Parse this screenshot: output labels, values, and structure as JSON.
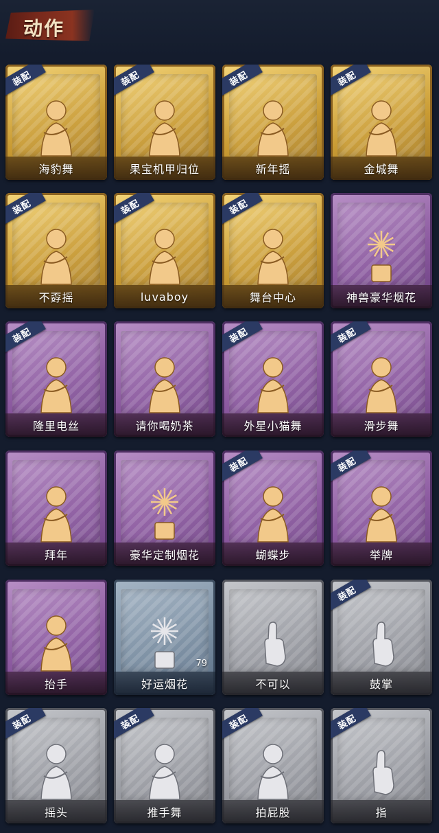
{
  "title": "动作",
  "equip_tag": "装配",
  "colors": {
    "gold": "#c99b33",
    "purple": "#8c5aa0",
    "blue": "#7a8ea2",
    "gray": "#9a9ca3",
    "tag": "#2b3a63"
  },
  "actions": [
    {
      "label": "海豹舞",
      "tier": "gold",
      "equipped": true,
      "icon": "dance-figure-icon"
    },
    {
      "label": "果宝机甲归位",
      "tier": "gold",
      "equipped": true,
      "icon": "dance-figure-icon"
    },
    {
      "label": "新年摇",
      "tier": "gold",
      "equipped": true,
      "icon": "dance-figure-icon"
    },
    {
      "label": "金城舞",
      "tier": "gold",
      "equipped": true,
      "icon": "dance-figure-icon"
    },
    {
      "label": "不孬摇",
      "tier": "gold",
      "equipped": true,
      "icon": "dance-figure-icon"
    },
    {
      "label": "luvaboy",
      "tier": "gold",
      "equipped": true,
      "icon": "dance-figure-icon"
    },
    {
      "label": "舞台中心",
      "tier": "gold",
      "equipped": true,
      "icon": "dance-figure-icon"
    },
    {
      "label": "神兽豪华烟花",
      "tier": "purple",
      "equipped": false,
      "icon": "firework-icon"
    },
    {
      "label": "隆里电丝",
      "tier": "purple",
      "equipped": true,
      "icon": "dance-figure-icon"
    },
    {
      "label": "请你喝奶茶",
      "tier": "purple",
      "equipped": false,
      "icon": "dance-figure-icon"
    },
    {
      "label": "外星小猫舞",
      "tier": "purple",
      "equipped": true,
      "icon": "dance-figure-icon"
    },
    {
      "label": "滑步舞",
      "tier": "purple",
      "equipped": true,
      "icon": "dance-figure-icon"
    },
    {
      "label": "拜年",
      "tier": "purple",
      "equipped": false,
      "icon": "dance-figure-icon"
    },
    {
      "label": "豪华定制烟花",
      "tier": "purple",
      "equipped": false,
      "icon": "firework-icon"
    },
    {
      "label": "蝴蝶步",
      "tier": "purple",
      "equipped": true,
      "icon": "dance-figure-icon"
    },
    {
      "label": "举牌",
      "tier": "purple",
      "equipped": true,
      "icon": "dance-figure-icon"
    },
    {
      "label": "抬手",
      "tier": "purple",
      "equipped": false,
      "icon": "dance-figure-icon"
    },
    {
      "label": "好运烟花",
      "tier": "blue",
      "equipped": false,
      "icon": "firework-icon",
      "count": "79"
    },
    {
      "label": "不可以",
      "tier": "gray",
      "equipped": false,
      "icon": "hand-icon"
    },
    {
      "label": "鼓掌",
      "tier": "gray",
      "equipped": true,
      "icon": "hand-icon"
    },
    {
      "label": "摇头",
      "tier": "gray",
      "equipped": true,
      "icon": "dance-figure-icon"
    },
    {
      "label": "推手舞",
      "tier": "gray",
      "equipped": true,
      "icon": "dance-figure-icon"
    },
    {
      "label": "拍屁股",
      "tier": "gray",
      "equipped": true,
      "icon": "dance-figure-icon"
    },
    {
      "label": "指",
      "tier": "gray",
      "equipped": true,
      "icon": "hand-icon"
    }
  ]
}
